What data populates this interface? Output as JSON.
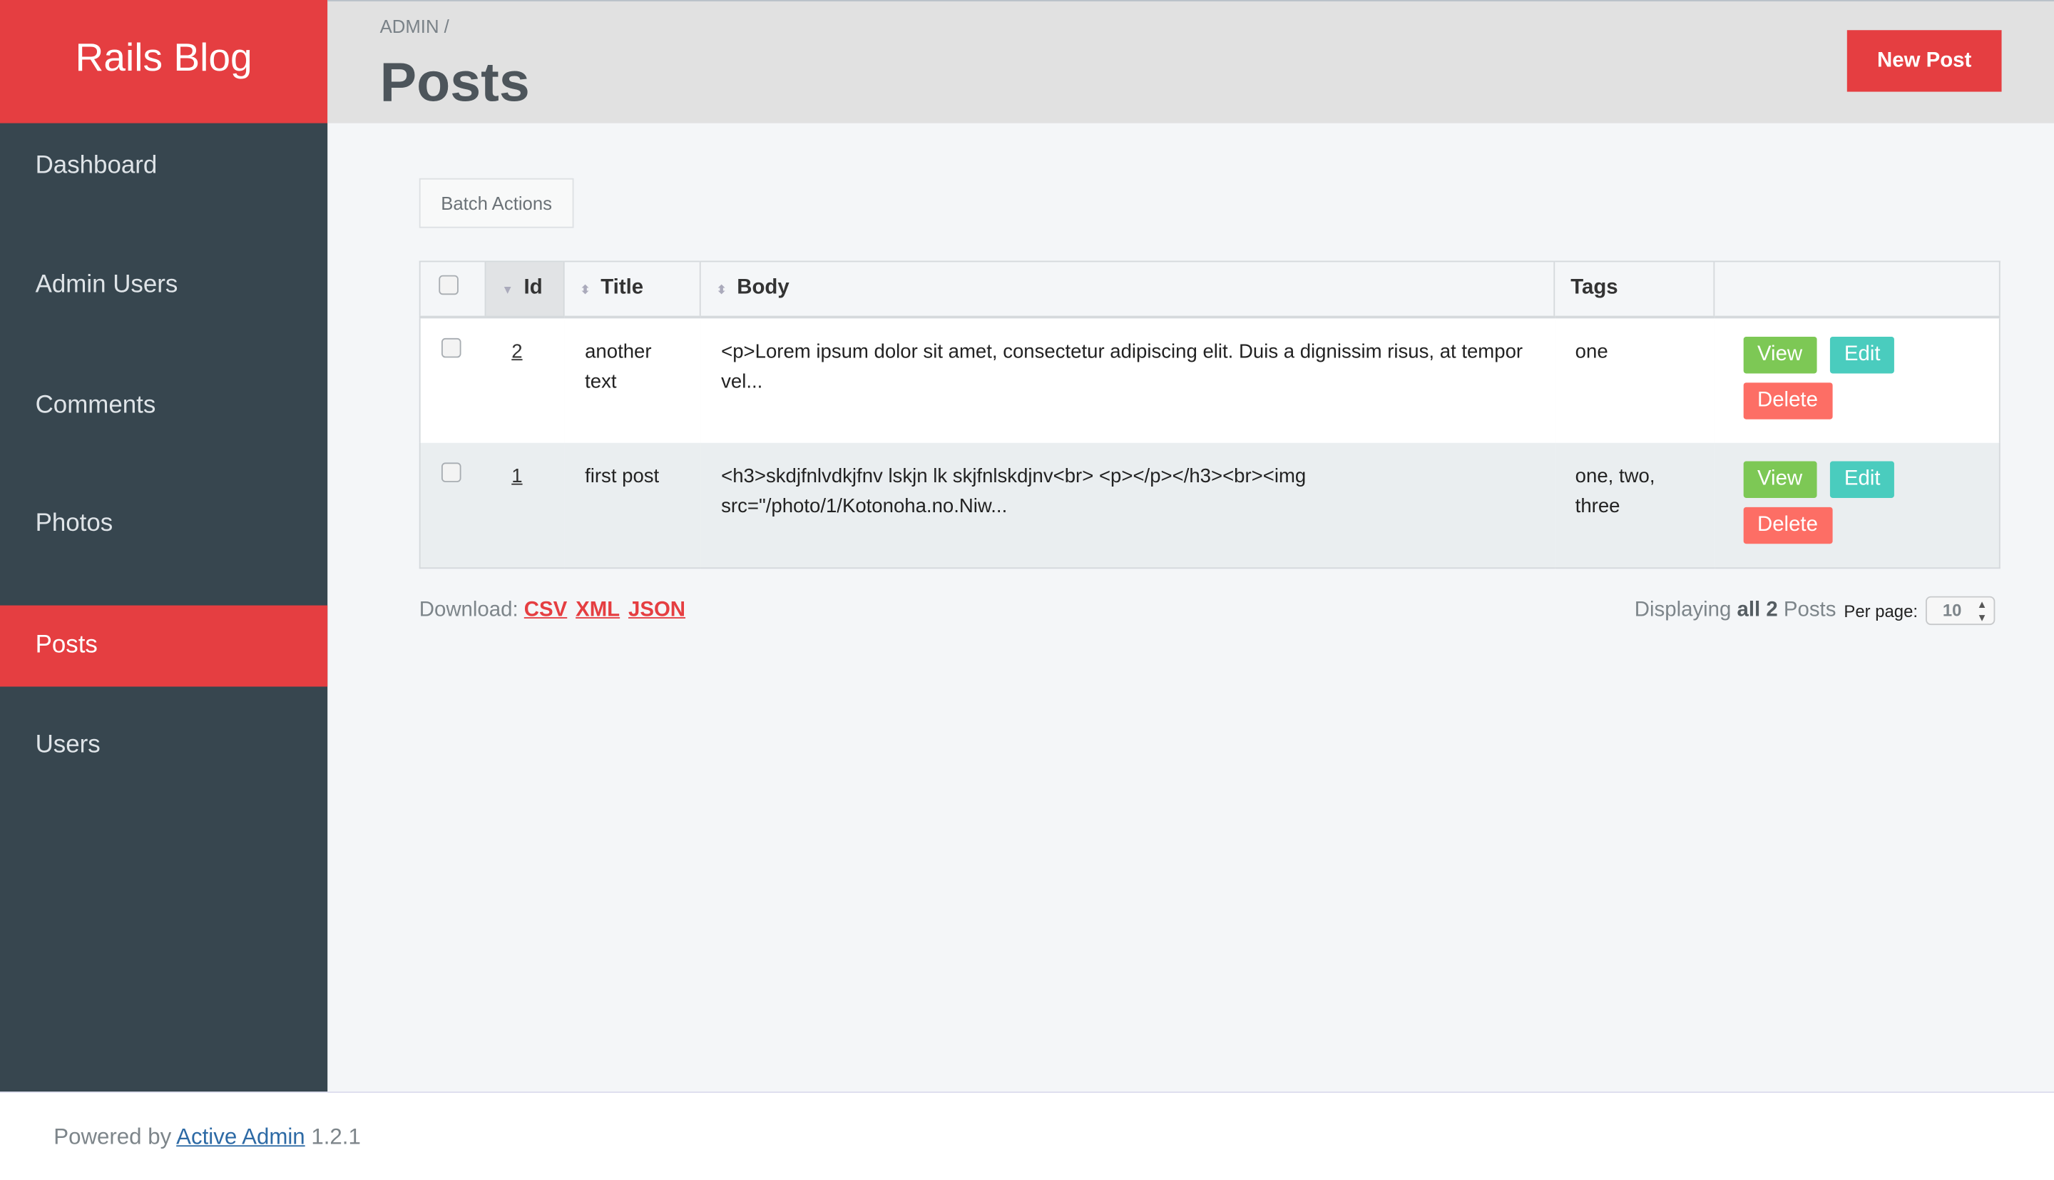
{
  "brand": "Rails Blog",
  "sidebar": {
    "items": [
      {
        "label": "Dashboard"
      },
      {
        "label": "Admin Users"
      },
      {
        "label": "Comments"
      },
      {
        "label": "Photos"
      },
      {
        "label": "Posts",
        "active": true
      },
      {
        "label": "Users"
      }
    ]
  },
  "header": {
    "breadcrumb": "ADMIN",
    "separator": "/",
    "title": "Posts",
    "new_button": "New Post"
  },
  "batch_actions": "Batch Actions",
  "table": {
    "columns": [
      "Id",
      "Title",
      "Body",
      "Tags"
    ],
    "sorted_column": "Id",
    "rows": [
      {
        "id": "2",
        "title": "another text",
        "body": "<p>Lorem ipsum dolor sit amet, consectetur adipiscing elit. Duis a dignissim risus, at tempor vel...",
        "tags": "one"
      },
      {
        "id": "1",
        "title": "first post",
        "body": "<h3>skdjfnlvdkjfnv lskjn lk skjfnlskdjnv<br> <p></p></h3><br><img src=\"/photo/1/Kotonoha.no.Niw...",
        "tags": "one, two, three"
      }
    ],
    "actions": {
      "view": "View",
      "edit": "Edit",
      "delete": "Delete"
    }
  },
  "download": {
    "label": "Download:",
    "formats": [
      "CSV",
      "XML",
      "JSON"
    ]
  },
  "pagination": {
    "prefix": "Displaying",
    "count": "all 2",
    "suffix": "Posts",
    "per_page_label": "Per page:",
    "per_page": "10"
  },
  "footer": {
    "prefix": "Powered by",
    "link": "Active Admin",
    "version": "1.2.1"
  },
  "colors": {
    "accent": "#e53e41",
    "sidebar": "#37464f",
    "view": "#7dc855",
    "edit": "#4accbe",
    "delete": "#fd6e65"
  }
}
